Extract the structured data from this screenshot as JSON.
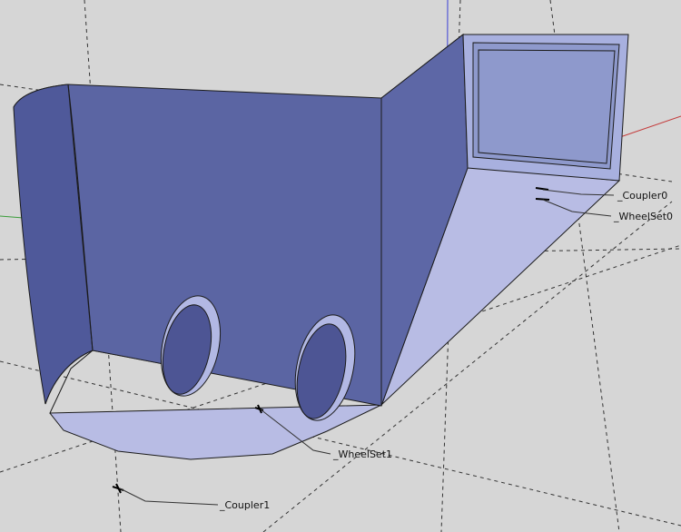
{
  "scene": {
    "background_color": "#d6d6d6",
    "body_color": "#5b65a3",
    "body_light_color": "#a9aedc",
    "floor_color": "#b8bce4",
    "panel_color": "#8e99cc",
    "edge_color": "#1b1b1b",
    "axis_blue": "#3a3fd6",
    "axis_red": "#c43b3b",
    "axis_green": "#3a9d3a"
  },
  "labels": {
    "coupler0": "_Coupler0",
    "wheelset0": "_WheelSet0",
    "wheelset1": "_WheelSet1",
    "coupler1": "_Coupler1"
  },
  "icons": {
    "coupler0_marker": "component-marker-icon",
    "wheelset0_marker": "component-marker-icon",
    "wheelset1_marker": "component-marker-icon",
    "coupler1_marker": "component-marker-icon"
  }
}
